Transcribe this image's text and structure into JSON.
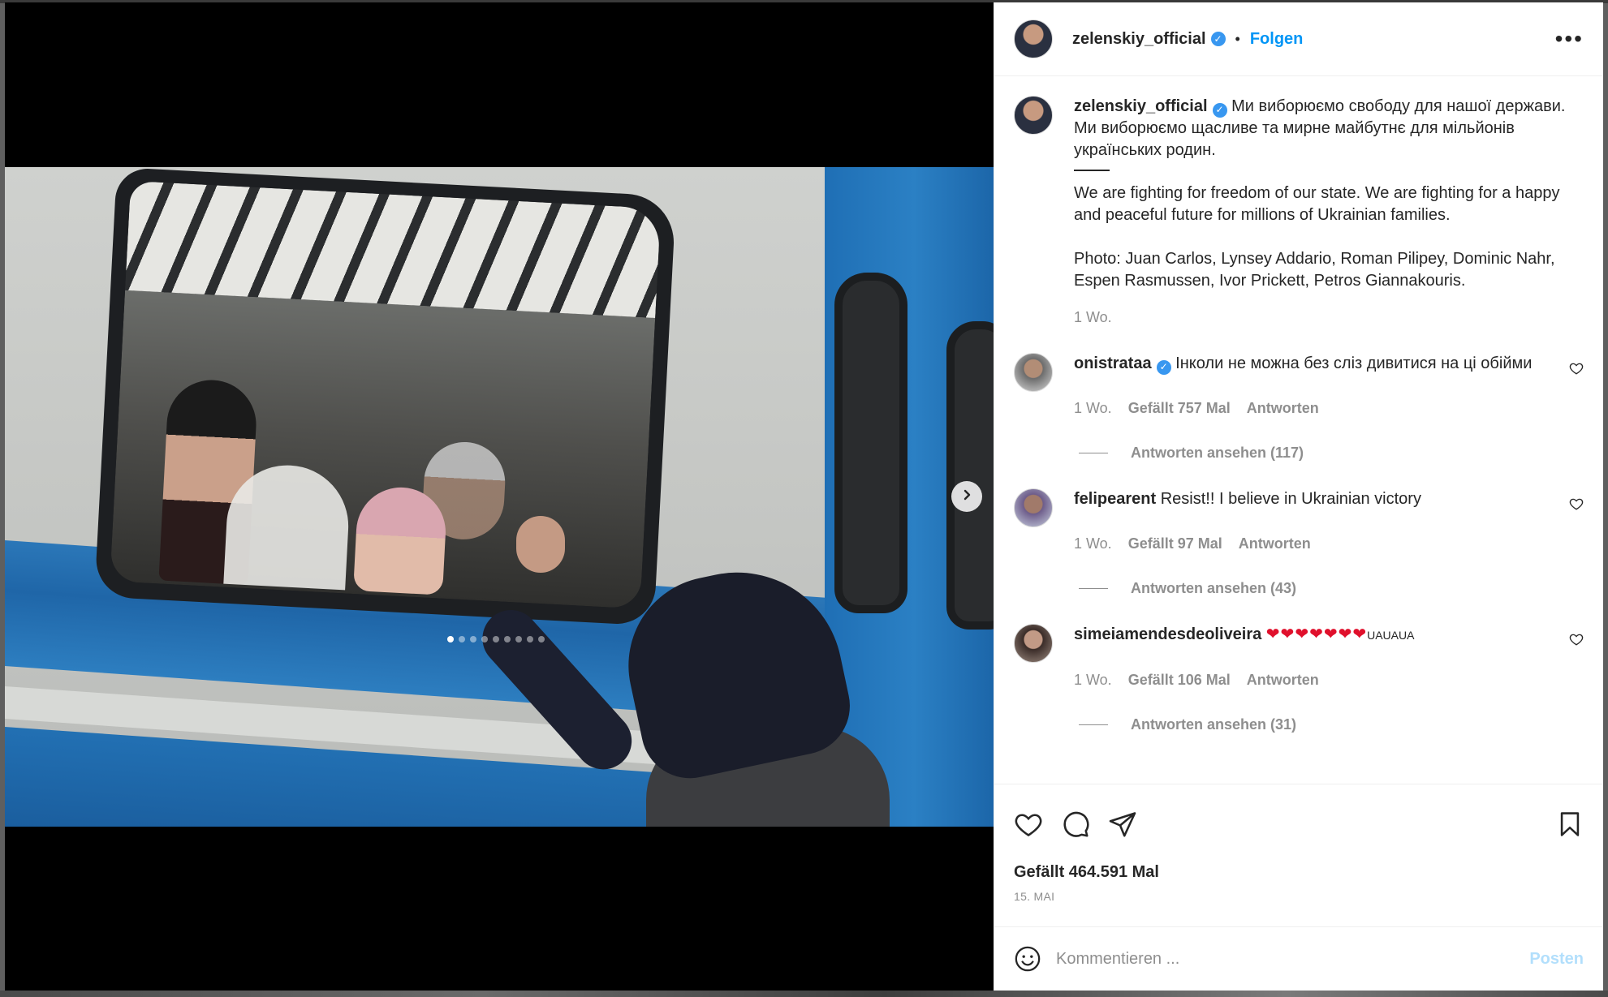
{
  "colors": {
    "accent": "#0095f6",
    "verified": "#3897f0",
    "muted": "#8e8e8e",
    "post_disabled": "#b2dffc"
  },
  "header": {
    "username": "zelenskiy_official",
    "bullet": "•",
    "follow_label": "Folgen",
    "more_label": "•••"
  },
  "media": {
    "slide_count": 9,
    "active_slide": 1,
    "next_icon": "chevron-right-icon"
  },
  "caption": {
    "username": "zelenskiy_official",
    "text_ua": "Ми виборюємо свободу для нашої держави. Ми виборюємо щасливе та мирне майбутнє для мільйонів українських родин.",
    "text_en": "We are fighting for freedom of our state. We are fighting for a happy and peaceful future for millions of Ukrainian families.",
    "credits": "Photo: Juan Carlos, Lynsey Addario, Roman Pilipey, Dominic Nahr, Espen Rasmussen, Ivor Prickett, Petros Giannakouris.",
    "time": "1 Wo."
  },
  "comments": [
    {
      "username": "onistrataa",
      "verified": true,
      "text": "Інколи не можна без сліз дивитися на ці обійми",
      "time": "1 Wo.",
      "likes": "Gefällt 757 Mal",
      "reply_label": "Antworten",
      "view_replies": "Antworten ansehen (117)"
    },
    {
      "username": "felipearent",
      "verified": false,
      "text": "Resist!! I believe in Ukrainian victory",
      "time": "1 Wo.",
      "likes": "Gefällt 97 Mal",
      "reply_label": "Antworten",
      "view_replies": "Antworten ansehen (43)"
    },
    {
      "username": "simeiamendesdeoliveira",
      "verified": false,
      "text_hearts": "❤❤❤❤❤❤❤",
      "text_suffix": "UAUAUA",
      "time": "1 Wo.",
      "likes": "Gefällt 106 Mal",
      "reply_label": "Antworten",
      "view_replies": "Antworten ansehen (31)"
    }
  ],
  "actions": {
    "like_icon": "heart-icon",
    "comment_icon": "comment-icon",
    "share_icon": "share-icon",
    "save_icon": "bookmark-icon"
  },
  "stats": {
    "likes": "Gefällt 464.591 Mal",
    "date": "15. MAI"
  },
  "composer": {
    "placeholder": "Kommentieren ...",
    "post_label": "Posten"
  }
}
